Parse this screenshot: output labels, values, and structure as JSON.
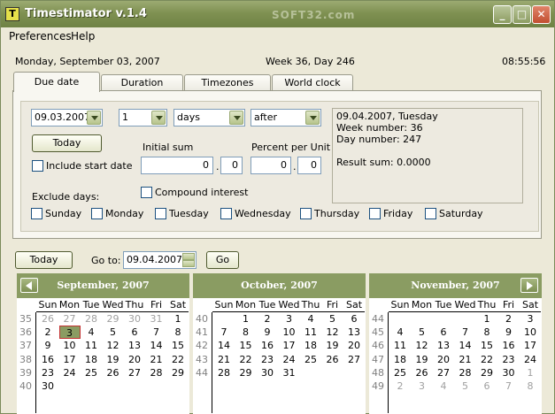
{
  "window": {
    "title": "Timestimator v.1.4",
    "watermark": "SOFT32.com"
  },
  "menu": [
    "Preferences",
    "Help"
  ],
  "info": {
    "date": "Monday, September 03, 2007",
    "week": "Week 36, Day 246",
    "time": "08:55:56"
  },
  "tabs": [
    "Due date",
    "Duration",
    "Timezones",
    "World clock"
  ],
  "due": {
    "date_value": "09.03.2007",
    "count_value": "1",
    "unit_value": "days",
    "direction_value": "after",
    "today_label": "Today",
    "include_start_label": "Include start date",
    "initial_sum_label": "Initial sum",
    "percent_label": "Percent per Unit",
    "initial_int": "0",
    "initial_dec": "0",
    "percent_int": "0",
    "percent_dec": "0",
    "compound_label": "Compound interest",
    "exclude_label": "Exclude days:",
    "days": [
      "Sunday",
      "Monday",
      "Tuesday",
      "Wednesday",
      "Thursday",
      "Friday",
      "Saturday"
    ],
    "result": {
      "line1": "09.04.2007, Tuesday",
      "line2": "Week number: 36",
      "line3": "Day number:   247",
      "line4": "Result sum: 0.0000"
    }
  },
  "nav": {
    "today_label": "Today",
    "goto_label": "Go to:",
    "goto_value": "09.04.2007",
    "go_label": "Go"
  },
  "calendar": {
    "day_names": [
      "Sun",
      "Mon",
      "Tue",
      "Wed",
      "Thu",
      "Fri",
      "Sat"
    ],
    "today_month_index": 0,
    "today_cell": "3",
    "months": [
      {
        "title": "September, 2007",
        "weeks": [
          "35",
          "36",
          "37",
          "38",
          "39",
          "40"
        ],
        "rows": [
          [
            "26",
            "27",
            "28",
            "29",
            "30",
            "31",
            "1"
          ],
          [
            "2",
            "3",
            "4",
            "5",
            "6",
            "7",
            "8"
          ],
          [
            "9",
            "10",
            "11",
            "12",
            "13",
            "14",
            "15"
          ],
          [
            "16",
            "17",
            "18",
            "19",
            "20",
            "21",
            "22"
          ],
          [
            "23",
            "24",
            "25",
            "26",
            "27",
            "28",
            "29"
          ],
          [
            "30",
            "",
            "",
            "",
            "",
            "",
            ""
          ]
        ],
        "other": [
          [
            1,
            1,
            1,
            1,
            1,
            1,
            0
          ],
          [
            0,
            0,
            0,
            0,
            0,
            0,
            0
          ],
          [
            0,
            0,
            0,
            0,
            0,
            0,
            0
          ],
          [
            0,
            0,
            0,
            0,
            0,
            0,
            0
          ],
          [
            0,
            0,
            0,
            0,
            0,
            0,
            0
          ],
          [
            0,
            0,
            0,
            0,
            0,
            0,
            0
          ]
        ]
      },
      {
        "title": "October, 2007",
        "weeks": [
          "40",
          "41",
          "42",
          "43",
          "44",
          ""
        ],
        "rows": [
          [
            "",
            "1",
            "2",
            "3",
            "4",
            "5",
            "6"
          ],
          [
            "7",
            "8",
            "9",
            "10",
            "11",
            "12",
            "13"
          ],
          [
            "14",
            "15",
            "16",
            "17",
            "18",
            "19",
            "20"
          ],
          [
            "21",
            "22",
            "23",
            "24",
            "25",
            "26",
            "27"
          ],
          [
            "28",
            "29",
            "30",
            "31",
            "",
            "",
            ""
          ],
          [
            "",
            "",
            "",
            "",
            "",
            "",
            ""
          ]
        ],
        "other": [
          [
            0,
            0,
            0,
            0,
            0,
            0,
            0
          ],
          [
            0,
            0,
            0,
            0,
            0,
            0,
            0
          ],
          [
            0,
            0,
            0,
            0,
            0,
            0,
            0
          ],
          [
            0,
            0,
            0,
            0,
            0,
            0,
            0
          ],
          [
            0,
            0,
            0,
            0,
            0,
            0,
            0
          ],
          [
            0,
            0,
            0,
            0,
            0,
            0,
            0
          ]
        ]
      },
      {
        "title": "November, 2007",
        "weeks": [
          "44",
          "45",
          "46",
          "47",
          "48",
          "49"
        ],
        "rows": [
          [
            "",
            "",
            "",
            "",
            "1",
            "2",
            "3"
          ],
          [
            "4",
            "5",
            "6",
            "7",
            "8",
            "9",
            "10"
          ],
          [
            "11",
            "12",
            "13",
            "14",
            "15",
            "16",
            "17"
          ],
          [
            "18",
            "19",
            "20",
            "21",
            "22",
            "23",
            "24"
          ],
          [
            "25",
            "26",
            "27",
            "28",
            "29",
            "30",
            "1"
          ],
          [
            "2",
            "3",
            "4",
            "5",
            "6",
            "7",
            "8"
          ]
        ],
        "other": [
          [
            0,
            0,
            0,
            0,
            0,
            0,
            0
          ],
          [
            0,
            0,
            0,
            0,
            0,
            0,
            0
          ],
          [
            0,
            0,
            0,
            0,
            0,
            0,
            0
          ],
          [
            0,
            0,
            0,
            0,
            0,
            0,
            0
          ],
          [
            0,
            0,
            0,
            0,
            0,
            0,
            1
          ],
          [
            1,
            1,
            1,
            1,
            1,
            1,
            1
          ]
        ]
      }
    ]
  }
}
